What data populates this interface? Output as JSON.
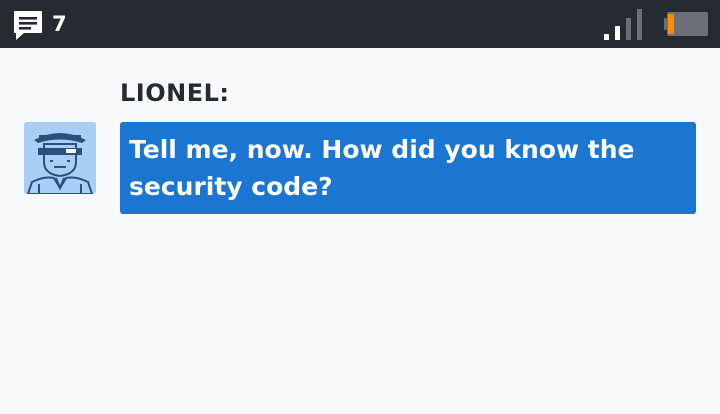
{
  "status_bar": {
    "message_icon": "message-icon",
    "message_count": "7",
    "signal_icon": "signal-strength-icon",
    "battery_icon": "battery-low-icon",
    "battery_level": 0.15,
    "colors": {
      "background": "#262b32",
      "battery_fill": "#ff8c00"
    }
  },
  "dialogue": {
    "speaker": "LIONEL:",
    "avatar_icon": "lionel-portrait",
    "message": "Tell me, now. How did you know the security code?",
    "colors": {
      "bubble": "#1b76d1",
      "text": "#ffffff",
      "avatar_bg": "#a9cff7"
    }
  }
}
